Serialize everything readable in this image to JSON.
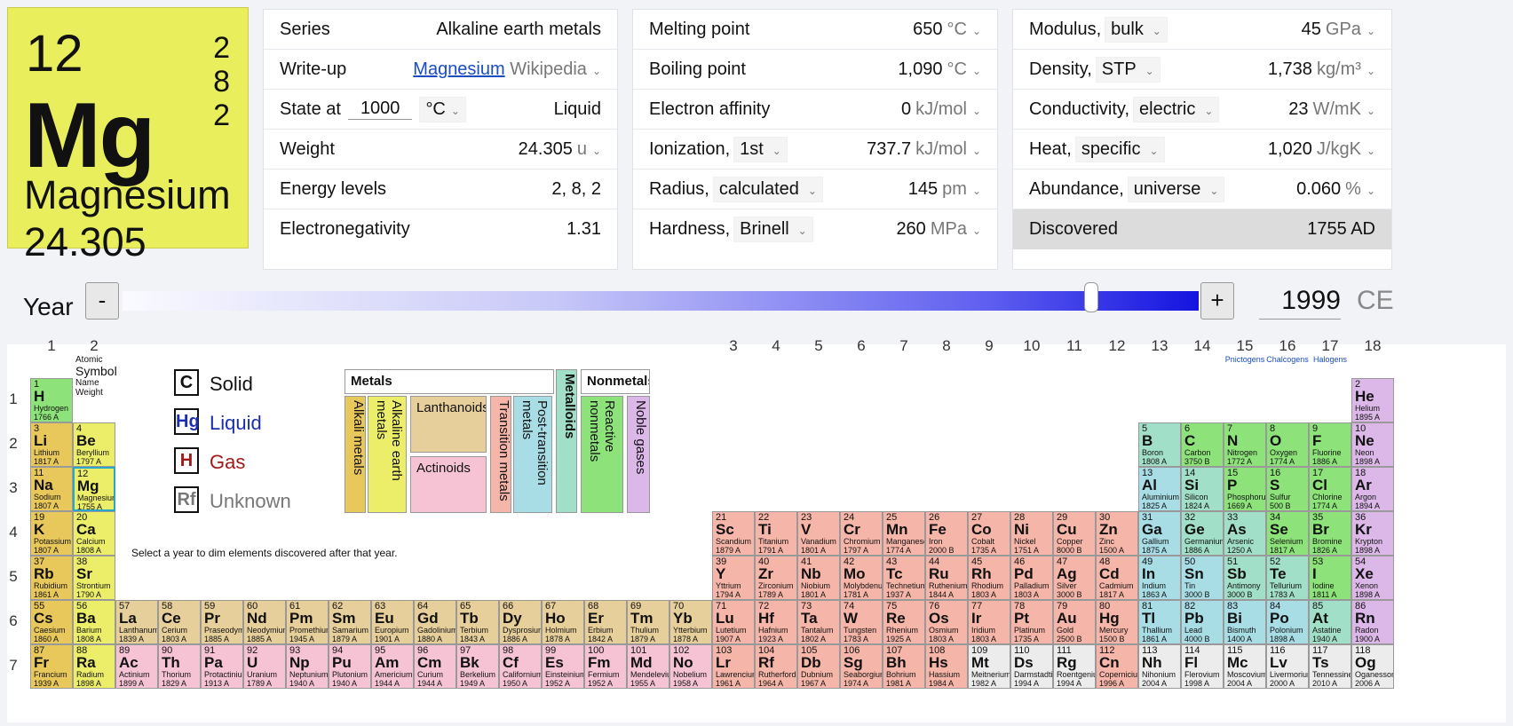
{
  "card": {
    "number": "12",
    "symbol": "Mg",
    "name": "Magnesium",
    "weight": "24.305",
    "shells": [
      "2",
      "8",
      "2"
    ]
  },
  "panel1": [
    {
      "label": "Series",
      "value": "Alkaline earth metals"
    },
    {
      "label": "Write-up",
      "link": "Magnesium",
      "value": "Wikipedia"
    },
    {
      "label": "State at",
      "input": "1000",
      "unit": "°C",
      "value": "Liquid"
    },
    {
      "label": "Weight",
      "value": "24.305",
      "unit": "u"
    },
    {
      "label": "Energy levels",
      "value": "2, 8, 2"
    },
    {
      "label": "Electronegativity",
      "value": "1.31"
    }
  ],
  "panel2": [
    {
      "label": "Melting point",
      "value": "650",
      "unit": "°C"
    },
    {
      "label": "Boiling point",
      "value": "1,090",
      "unit": "°C"
    },
    {
      "label": "Electron affinity",
      "value": "0",
      "unit": "kJ/mol"
    },
    {
      "label": "Ionization,",
      "select": "1st",
      "value": "737.7",
      "unit": "kJ/mol"
    },
    {
      "label": "Radius,",
      "select": "calculated",
      "value": "145",
      "unit": "pm"
    },
    {
      "label": "Hardness,",
      "select": "Brinell",
      "value": "260",
      "unit": "MPa"
    }
  ],
  "panel3": [
    {
      "label": "Modulus,",
      "select": "bulk",
      "value": "45",
      "unit": "GPa"
    },
    {
      "label": "Density,",
      "select": "STP",
      "value": "1,738",
      "unit": "kg/m³"
    },
    {
      "label": "Conductivity,",
      "select": "electric",
      "value": "23",
      "unit": "W/mK"
    },
    {
      "label": "Heat,",
      "select": "specific",
      "value": "1,020",
      "unit": "J/kgK"
    },
    {
      "label": "Abundance,",
      "select": "universe",
      "value": "0.060",
      "unit": "%"
    },
    {
      "label": "Discovered",
      "value": "1755 AD"
    }
  ],
  "year": {
    "label": "Year",
    "minus": "-",
    "plus": "+",
    "value": "1999",
    "era": "CE",
    "slider_fraction": 0.9
  },
  "hint": "Select a year to dim elements discovered after that year.",
  "legend": {
    "header": [
      "Atomic",
      "Symbol",
      "Name",
      "Weight"
    ],
    "states": [
      {
        "sym": "C",
        "label": "Solid",
        "color": "#111111"
      },
      {
        "sym": "Hg",
        "label": "Liquid",
        "color": "#1a2fb0"
      },
      {
        "sym": "H",
        "label": "Gas",
        "color": "#a11a1a"
      },
      {
        "sym": "Rf",
        "label": "Unknown",
        "color": "#777777"
      }
    ]
  },
  "groups": [
    "1",
    "2",
    "3",
    "4",
    "5",
    "6",
    "7",
    "8",
    "9",
    "10",
    "11",
    "12",
    "13",
    "14",
    "15",
    "16",
    "17",
    "18"
  ],
  "group_subs": {
    "15": "Pnictogens",
    "16": "Chalcogens",
    "17": "Halogens"
  },
  "periods": [
    "1",
    "2",
    "3",
    "4",
    "5",
    "6",
    "7"
  ],
  "categories": {
    "metals": "Metals",
    "nonmetals": "Nonmetals",
    "metalloids": "Metalloids",
    "alkali": "Alkali metals",
    "alkaline": "Alkaline earth metals",
    "lanth": "Lanthanoids",
    "actin": "Actinoids",
    "trans": "Transition metals",
    "post": "Post-transition metals",
    "reactive": "Reactive nonmetals",
    "noble": "Noble gases"
  },
  "colors": {
    "alkali": "#e8c85a",
    "alkaline": "#ecee6a",
    "lanth": "#e6cf9b",
    "actin": "#f5c3d3",
    "trans": "#f5b5a8",
    "post": "#a8dde6",
    "metalloid": "#a2dfc8",
    "reactive": "#8de37a",
    "noble": "#dcb8e8",
    "unknown": "#ececec"
  },
  "elements": [
    [
      "1",
      "H",
      "Hydrogen",
      "1766 A",
      1,
      1,
      "reactive"
    ],
    [
      "2",
      "He",
      "Helium",
      "1895 A",
      18,
      1,
      "noble"
    ],
    [
      "3",
      "Li",
      "Lithium",
      "1817 A",
      1,
      2,
      "alkali"
    ],
    [
      "4",
      "Be",
      "Beryllium",
      "1797 A",
      2,
      2,
      "alkaline"
    ],
    [
      "5",
      "B",
      "Boron",
      "1808 A",
      13,
      2,
      "metalloid"
    ],
    [
      "6",
      "C",
      "Carbon",
      "3750 B",
      14,
      2,
      "reactive"
    ],
    [
      "7",
      "N",
      "Nitrogen",
      "1772 A",
      15,
      2,
      "reactive"
    ],
    [
      "8",
      "O",
      "Oxygen",
      "1774 A",
      16,
      2,
      "reactive"
    ],
    [
      "9",
      "F",
      "Fluorine",
      "1886 A",
      17,
      2,
      "reactive"
    ],
    [
      "10",
      "Ne",
      "Neon",
      "1898 A",
      18,
      2,
      "noble"
    ],
    [
      "11",
      "Na",
      "Sodium",
      "1807 A",
      1,
      3,
      "alkali"
    ],
    [
      "12",
      "Mg",
      "Magnesium",
      "1755 A",
      2,
      3,
      "alkaline"
    ],
    [
      "13",
      "Al",
      "Aluminium",
      "1825 A",
      13,
      3,
      "post"
    ],
    [
      "14",
      "Si",
      "Silicon",
      "1824 A",
      14,
      3,
      "metalloid"
    ],
    [
      "15",
      "P",
      "Phosphorus",
      "1669 A",
      15,
      3,
      "reactive"
    ],
    [
      "16",
      "S",
      "Sulfur",
      "500 B",
      16,
      3,
      "reactive"
    ],
    [
      "17",
      "Cl",
      "Chlorine",
      "1774 A",
      17,
      3,
      "reactive"
    ],
    [
      "18",
      "Ar",
      "Argon",
      "1894 A",
      18,
      3,
      "noble"
    ],
    [
      "19",
      "K",
      "Potassium",
      "1807 A",
      1,
      4,
      "alkali"
    ],
    [
      "20",
      "Ca",
      "Calcium",
      "1808 A",
      2,
      4,
      "alkaline"
    ],
    [
      "21",
      "Sc",
      "Scandium",
      "1879 A",
      3,
      4,
      "trans"
    ],
    [
      "22",
      "Ti",
      "Titanium",
      "1791 A",
      4,
      4,
      "trans"
    ],
    [
      "23",
      "V",
      "Vanadium",
      "1801 A",
      5,
      4,
      "trans"
    ],
    [
      "24",
      "Cr",
      "Chromium",
      "1797 A",
      6,
      4,
      "trans"
    ],
    [
      "25",
      "Mn",
      "Manganese",
      "1774 A",
      7,
      4,
      "trans"
    ],
    [
      "26",
      "Fe",
      "Iron",
      "2000 B",
      8,
      4,
      "trans"
    ],
    [
      "27",
      "Co",
      "Cobalt",
      "1735 A",
      9,
      4,
      "trans"
    ],
    [
      "28",
      "Ni",
      "Nickel",
      "1751 A",
      10,
      4,
      "trans"
    ],
    [
      "29",
      "Cu",
      "Copper",
      "8000 B",
      11,
      4,
      "trans"
    ],
    [
      "30",
      "Zn",
      "Zinc",
      "1500 A",
      12,
      4,
      "trans"
    ],
    [
      "31",
      "Ga",
      "Gallium",
      "1875 A",
      13,
      4,
      "post"
    ],
    [
      "32",
      "Ge",
      "Germanium",
      "1886 A",
      14,
      4,
      "metalloid"
    ],
    [
      "33",
      "As",
      "Arsenic",
      "1250 A",
      15,
      4,
      "metalloid"
    ],
    [
      "34",
      "Se",
      "Selenium",
      "1817 A",
      16,
      4,
      "reactive"
    ],
    [
      "35",
      "Br",
      "Bromine",
      "1826 A",
      17,
      4,
      "reactive"
    ],
    [
      "36",
      "Kr",
      "Krypton",
      "1898 A",
      18,
      4,
      "noble"
    ],
    [
      "37",
      "Rb",
      "Rubidium",
      "1861 A",
      1,
      5,
      "alkali"
    ],
    [
      "38",
      "Sr",
      "Strontium",
      "1790 A",
      2,
      5,
      "alkaline"
    ],
    [
      "39",
      "Y",
      "Yttrium",
      "1794 A",
      3,
      5,
      "trans"
    ],
    [
      "40",
      "Zr",
      "Zirconium",
      "1789 A",
      4,
      5,
      "trans"
    ],
    [
      "41",
      "Nb",
      "Niobium",
      "1801 A",
      5,
      5,
      "trans"
    ],
    [
      "42",
      "Mo",
      "Molybdenum",
      "1781 A",
      6,
      5,
      "trans"
    ],
    [
      "43",
      "Tc",
      "Technetium",
      "1937 A",
      7,
      5,
      "trans"
    ],
    [
      "44",
      "Ru",
      "Ruthenium",
      "1844 A",
      8,
      5,
      "trans"
    ],
    [
      "45",
      "Rh",
      "Rhodium",
      "1803 A",
      9,
      5,
      "trans"
    ],
    [
      "46",
      "Pd",
      "Palladium",
      "1803 A",
      10,
      5,
      "trans"
    ],
    [
      "47",
      "Ag",
      "Silver",
      "3000 B",
      11,
      5,
      "trans"
    ],
    [
      "48",
      "Cd",
      "Cadmium",
      "1817 A",
      12,
      5,
      "trans"
    ],
    [
      "49",
      "In",
      "Indium",
      "1863 A",
      13,
      5,
      "post"
    ],
    [
      "50",
      "Sn",
      "Tin",
      "3000 B",
      14,
      5,
      "post"
    ],
    [
      "51",
      "Sb",
      "Antimony",
      "3000 B",
      15,
      5,
      "metalloid"
    ],
    [
      "52",
      "Te",
      "Tellurium",
      "1783 A",
      16,
      5,
      "metalloid"
    ],
    [
      "53",
      "I",
      "Iodine",
      "1811 A",
      17,
      5,
      "reactive"
    ],
    [
      "54",
      "Xe",
      "Xenon",
      "1898 A",
      18,
      5,
      "noble"
    ],
    [
      "55",
      "Cs",
      "Caesium",
      "1860 A",
      1,
      6,
      "alkali"
    ],
    [
      "56",
      "Ba",
      "Barium",
      "1808 A",
      2,
      6,
      "alkaline"
    ],
    [
      "57",
      "La",
      "Lanthanum",
      "1839 A",
      3,
      6,
      "lanth"
    ],
    [
      "58",
      "Ce",
      "Cerium",
      "1803 A",
      4,
      6,
      "lanth"
    ],
    [
      "59",
      "Pr",
      "Praseodymium",
      "1885 A",
      5,
      6,
      "lanth"
    ],
    [
      "60",
      "Nd",
      "Neodymium",
      "1885 A",
      6,
      6,
      "lanth"
    ],
    [
      "61",
      "Pm",
      "Promethium",
      "1945 A",
      7,
      6,
      "lanth"
    ],
    [
      "62",
      "Sm",
      "Samarium",
      "1879 A",
      8,
      6,
      "lanth"
    ],
    [
      "63",
      "Eu",
      "Europium",
      "1901 A",
      9,
      6,
      "lanth"
    ],
    [
      "64",
      "Gd",
      "Gadolinium",
      "1880 A",
      10,
      6,
      "lanth"
    ],
    [
      "65",
      "Tb",
      "Terbium",
      "1843 A",
      11,
      6,
      "lanth"
    ],
    [
      "66",
      "Dy",
      "Dysprosium",
      "1886 A",
      12,
      6,
      "lanth"
    ],
    [
      "67",
      "Ho",
      "Holmium",
      "1878 A",
      13,
      6,
      "lanth"
    ],
    [
      "68",
      "Er",
      "Erbium",
      "1842 A",
      14,
      6,
      "lanth"
    ],
    [
      "69",
      "Tm",
      "Thulium",
      "1879 A",
      15,
      6,
      "lanth"
    ],
    [
      "70",
      "Yb",
      "Ytterbium",
      "1878 A",
      16,
      6,
      "lanth"
    ],
    [
      "71",
      "Lu",
      "Lutetium",
      "1907 A",
      17,
      6,
      "trans"
    ],
    [
      "72",
      "Hf",
      "Hafnium",
      "1923 A",
      18,
      6,
      "trans"
    ],
    [
      "73",
      "Ta",
      "Tantalum",
      "1802 A",
      19,
      6,
      "trans"
    ],
    [
      "74",
      "W",
      "Tungsten",
      "1783 A",
      20,
      6,
      "trans"
    ],
    [
      "75",
      "Re",
      "Rhenium",
      "1925 A",
      21,
      6,
      "trans"
    ],
    [
      "76",
      "Os",
      "Osmium",
      "1803 A",
      22,
      6,
      "trans"
    ],
    [
      "77",
      "Ir",
      "Iridium",
      "1803 A",
      23,
      6,
      "trans"
    ],
    [
      "78",
      "Pt",
      "Platinum",
      "1735 A",
      24,
      6,
      "trans"
    ],
    [
      "79",
      "Au",
      "Gold",
      "2500 B",
      25,
      6,
      "trans"
    ],
    [
      "80",
      "Hg",
      "Mercury",
      "1500 B",
      26,
      6,
      "trans"
    ],
    [
      "81",
      "Tl",
      "Thallium",
      "1861 A",
      27,
      6,
      "post"
    ],
    [
      "82",
      "Pb",
      "Lead",
      "4000 B",
      28,
      6,
      "post"
    ],
    [
      "83",
      "Bi",
      "Bismuth",
      "1400 A",
      29,
      6,
      "post"
    ],
    [
      "84",
      "Po",
      "Polonium",
      "1898 A",
      30,
      6,
      "post"
    ],
    [
      "85",
      "At",
      "Astatine",
      "1940 A",
      31,
      6,
      "metalloid"
    ],
    [
      "86",
      "Rn",
      "Radon",
      "1900 A",
      32,
      6,
      "noble"
    ],
    [
      "87",
      "Fr",
      "Francium",
      "1939 A",
      1,
      7,
      "alkali"
    ],
    [
      "88",
      "Ra",
      "Radium",
      "1898 A",
      2,
      7,
      "alkaline"
    ],
    [
      "89",
      "Ac",
      "Actinium",
      "1899 A",
      3,
      7,
      "actin"
    ],
    [
      "90",
      "Th",
      "Thorium",
      "1829 A",
      4,
      7,
      "actin"
    ],
    [
      "91",
      "Pa",
      "Protactinium",
      "1913 A",
      5,
      7,
      "actin"
    ],
    [
      "92",
      "U",
      "Uranium",
      "1789 A",
      6,
      7,
      "actin"
    ],
    [
      "93",
      "Np",
      "Neptunium",
      "1940 A",
      7,
      7,
      "actin"
    ],
    [
      "94",
      "Pu",
      "Plutonium",
      "1940 A",
      8,
      7,
      "actin"
    ],
    [
      "95",
      "Am",
      "Americium",
      "1944 A",
      9,
      7,
      "actin"
    ],
    [
      "96",
      "Cm",
      "Curium",
      "1944 A",
      10,
      7,
      "actin"
    ],
    [
      "97",
      "Bk",
      "Berkelium",
      "1949 A",
      11,
      7,
      "actin"
    ],
    [
      "98",
      "Cf",
      "Californium",
      "1950 A",
      12,
      7,
      "actin"
    ],
    [
      "99",
      "Es",
      "Einsteinium",
      "1952 A",
      13,
      7,
      "actin"
    ],
    [
      "100",
      "Fm",
      "Fermium",
      "1952 A",
      14,
      7,
      "actin"
    ],
    [
      "101",
      "Md",
      "Mendelevium",
      "1955 A",
      15,
      7,
      "actin"
    ],
    [
      "102",
      "No",
      "Nobelium",
      "1958 A",
      16,
      7,
      "actin"
    ],
    [
      "103",
      "Lr",
      "Lawrencium",
      "1961 A",
      17,
      7,
      "trans"
    ],
    [
      "104",
      "Rf",
      "Rutherfordium",
      "1964 A",
      18,
      7,
      "trans"
    ],
    [
      "105",
      "Db",
      "Dubnium",
      "1967 A",
      19,
      7,
      "trans"
    ],
    [
      "106",
      "Sg",
      "Seaborgium",
      "1974 A",
      20,
      7,
      "trans"
    ],
    [
      "107",
      "Bh",
      "Bohrium",
      "1981 A",
      21,
      7,
      "trans"
    ],
    [
      "108",
      "Hs",
      "Hassium",
      "1984 A",
      22,
      7,
      "trans"
    ],
    [
      "109",
      "Mt",
      "Meitnerium",
      "1982 A",
      23,
      7,
      "unknown"
    ],
    [
      "110",
      "Ds",
      "Darmstadtium",
      "1994 A",
      24,
      7,
      "unknown"
    ],
    [
      "111",
      "Rg",
      "Roentgenium",
      "1994 A",
      25,
      7,
      "unknown"
    ],
    [
      "112",
      "Cn",
      "Copernicium",
      "1996 A",
      26,
      7,
      "trans"
    ],
    [
      "113",
      "Nh",
      "Nihonium",
      "2004 A",
      27,
      7,
      "unknown"
    ],
    [
      "114",
      "Fl",
      "Flerovium",
      "1998 A",
      28,
      7,
      "unknown"
    ],
    [
      "115",
      "Mc",
      "Moscovium",
      "2004 A",
      29,
      7,
      "unknown"
    ],
    [
      "116",
      "Lv",
      "Livermorium",
      "2000 A",
      30,
      7,
      "unknown"
    ],
    [
      "117",
      "Ts",
      "Tennessine",
      "2010 A",
      31,
      7,
      "unknown"
    ],
    [
      "118",
      "Og",
      "Oganesson",
      "2006 A",
      32,
      7,
      "unknown"
    ]
  ]
}
